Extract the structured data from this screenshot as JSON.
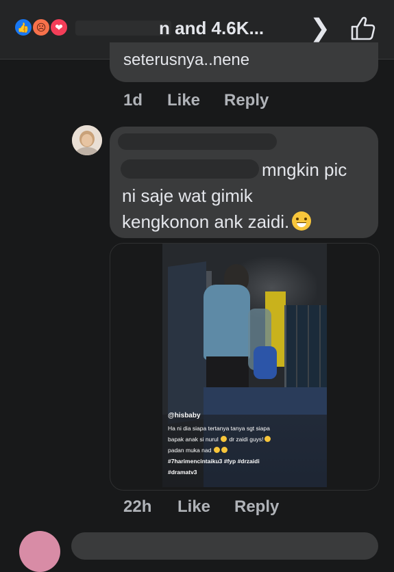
{
  "header": {
    "reactions": [
      "like-icon",
      "angry-icon",
      "love-icon"
    ],
    "reactor_text": "n and 4.6K..."
  },
  "comments": [
    {
      "text": "seterusnya..nene",
      "time": "1d",
      "like_label": "Like",
      "reply_label": "Reply"
    },
    {
      "lines": [
        "mngkin pic",
        "ni saje wat gimik",
        "kengkonon ank zaidi."
      ],
      "emoji": "grinning-sweat-emoji"
    },
    {
      "time": "22h",
      "like_label": "Like",
      "reply_label": "Reply"
    }
  ],
  "video_caption": {
    "handle": "@hisbaby",
    "lines": [
      "Ha ni dia siapa tertanya tanya sgt siapa",
      "bapak anak si nurul",
      "dr zaidi guys!",
      "padan muka nad"
    ],
    "hashtags": [
      "#7harimencintaiku3 #fyp #drzaidi",
      "#dramatv3"
    ]
  },
  "colors": {
    "background": "#18191a",
    "bubble": "#3a3b3c",
    "like_blue": "#1877f2"
  }
}
